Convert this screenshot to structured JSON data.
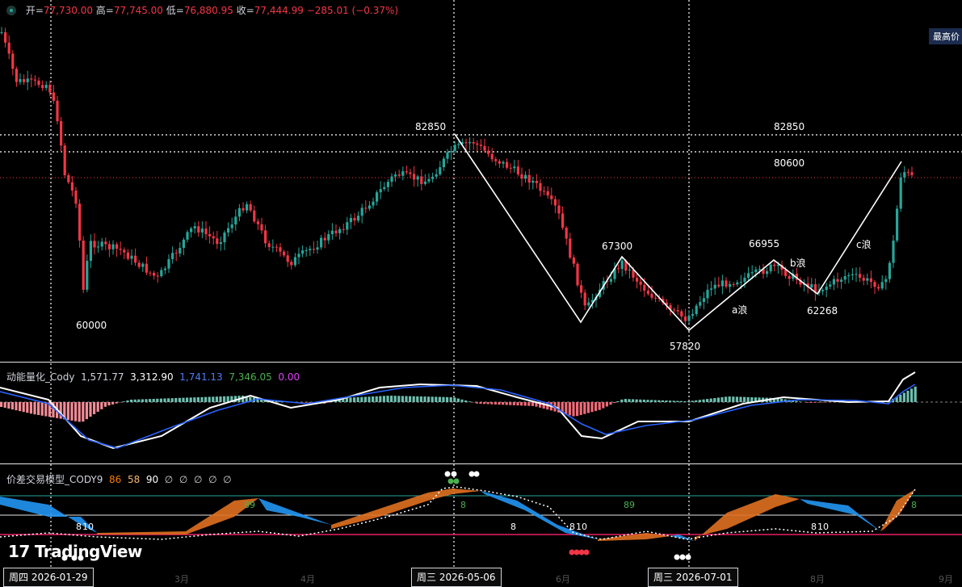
{
  "ohlc": {
    "open_label": "开=",
    "open": "77,730.00",
    "high_label": "高=",
    "high": "77,745.00",
    "low_label": "低=",
    "low": "76,880.95",
    "close_label": "收=",
    "close": "77,444.99",
    "change": "−285.01 (−0.37%)"
  },
  "price_tag": "最高价",
  "wave_labels": {
    "p60000": "60000",
    "p82850_left": "82850",
    "p82850_right": "82850",
    "p80600": "80600",
    "p67300": "67300",
    "p66955": "66955",
    "p57820": "57820",
    "p62268": "62268",
    "a_wave": "a浪",
    "b_wave": "b浪",
    "c_wave": "c浪"
  },
  "indicator1": {
    "name": "动能量化_Cody",
    "v1": "1,571.77",
    "v2": "3,312.90",
    "v3": "1,741.13",
    "v4": "7,346.05",
    "v5": "0.00",
    "colors": {
      "v1": "#d1d4dc",
      "v2": "#ffffff",
      "v3": "#4f7df0",
      "v4": "#4caf50",
      "v5": "#e040fb"
    }
  },
  "indicator2": {
    "name": "价差交易模型_CODY9",
    "v1": "86",
    "v2": "58",
    "v3": "90",
    "empty_symbols": [
      "∅",
      "∅",
      "∅",
      "∅",
      "∅"
    ]
  },
  "oscillator_labels": {
    "l1": "8",
    "l2": "10",
    "l3": "8",
    "l4": "89",
    "l5": "8",
    "l6": "8",
    "l7": "10",
    "l8": "89",
    "l9": "8",
    "l10": "10",
    "l11": "8"
  },
  "date_tags": [
    "周四 2026-01-29",
    "周三 2026-05-06",
    "周三 2026-07-01"
  ],
  "month_labels": [
    "3月",
    "4月",
    "6月",
    "8月",
    "9月"
  ],
  "logo_text": "TradingView",
  "colors": {
    "up": "#26a69a",
    "down": "#f23645",
    "blue": "#2962ff",
    "orange": "#f57c00"
  }
}
